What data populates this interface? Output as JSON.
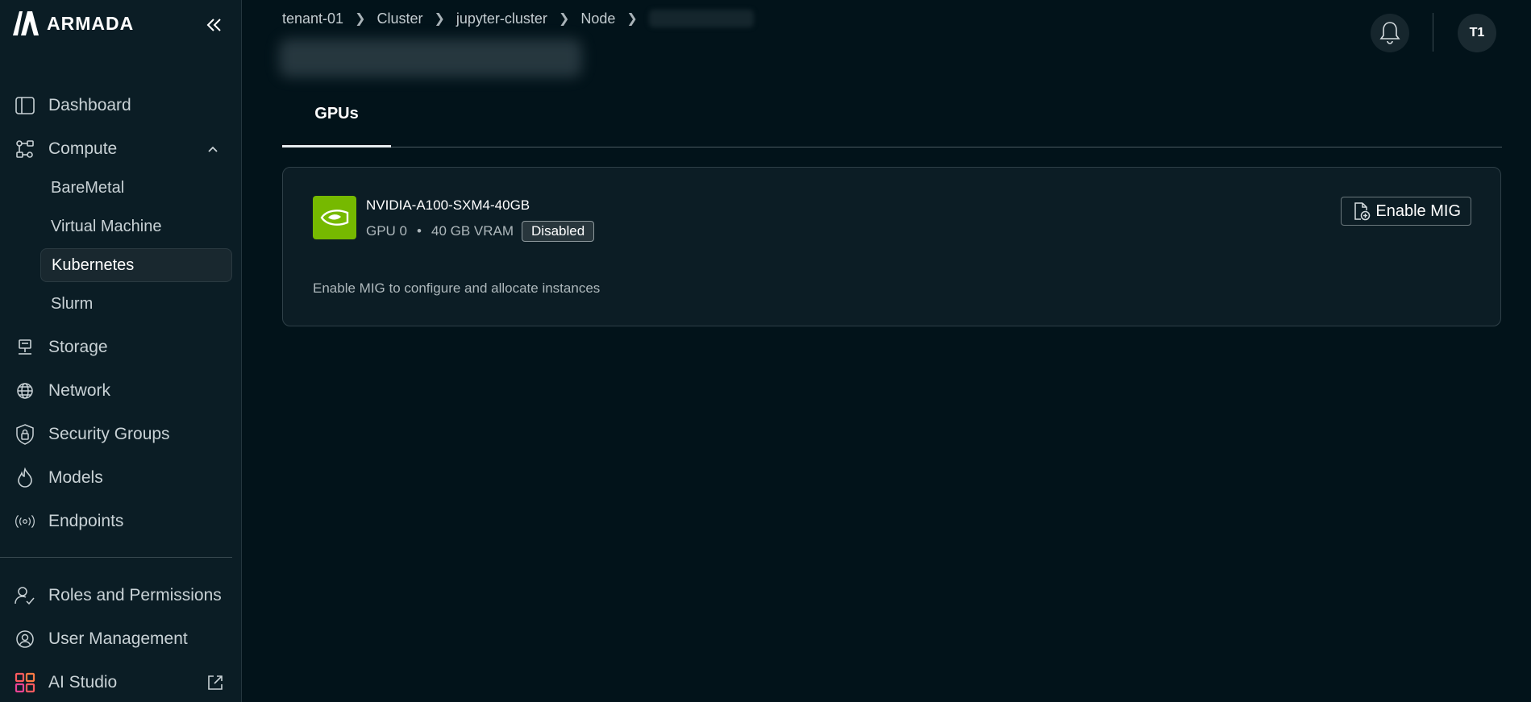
{
  "app": {
    "brand": "ARMADA"
  },
  "sidebar": {
    "items": [
      {
        "label": "Dashboard",
        "icon": "sidebar-panel-icon"
      },
      {
        "label": "Compute",
        "icon": "compute-nodes-icon"
      },
      {
        "label": "Storage",
        "icon": "storage-icon"
      },
      {
        "label": "Network",
        "icon": "globe-icon"
      },
      {
        "label": "Security Groups",
        "icon": "lock-shield-icon"
      },
      {
        "label": "Models",
        "icon": "flame-icon"
      },
      {
        "label": "Endpoints",
        "icon": "broadcast-icon"
      },
      {
        "label": "Roles and Permissions",
        "icon": "user-check-icon"
      },
      {
        "label": "User Management",
        "icon": "user-gear-icon"
      },
      {
        "label": "AI Studio",
        "icon": "grid-apps-icon"
      }
    ],
    "compute_sub": [
      {
        "label": "BareMetal",
        "active": false
      },
      {
        "label": "Virtual Machine",
        "active": false
      },
      {
        "label": "Kubernetes",
        "active": true
      },
      {
        "label": "Slurm",
        "active": false
      }
    ]
  },
  "breadcrumb": [
    "tenant-01",
    "Cluster",
    "jupyter-cluster",
    "Node"
  ],
  "header": {
    "avatar_initials": "T1"
  },
  "tabs": [
    {
      "label": "GPUs",
      "active": true
    }
  ],
  "gpu_card": {
    "name": "NVIDIA-A100-SXM4-40GB",
    "index": "GPU 0",
    "vram": "40 GB VRAM",
    "status": "Disabled",
    "hint": "Enable MIG to configure and allocate instances",
    "action_label": "Enable MIG",
    "brand_color": "#76b900"
  },
  "colors": {
    "background": "#02131a",
    "sidebar": "#0b1d25",
    "accent_green": "#76b900"
  }
}
